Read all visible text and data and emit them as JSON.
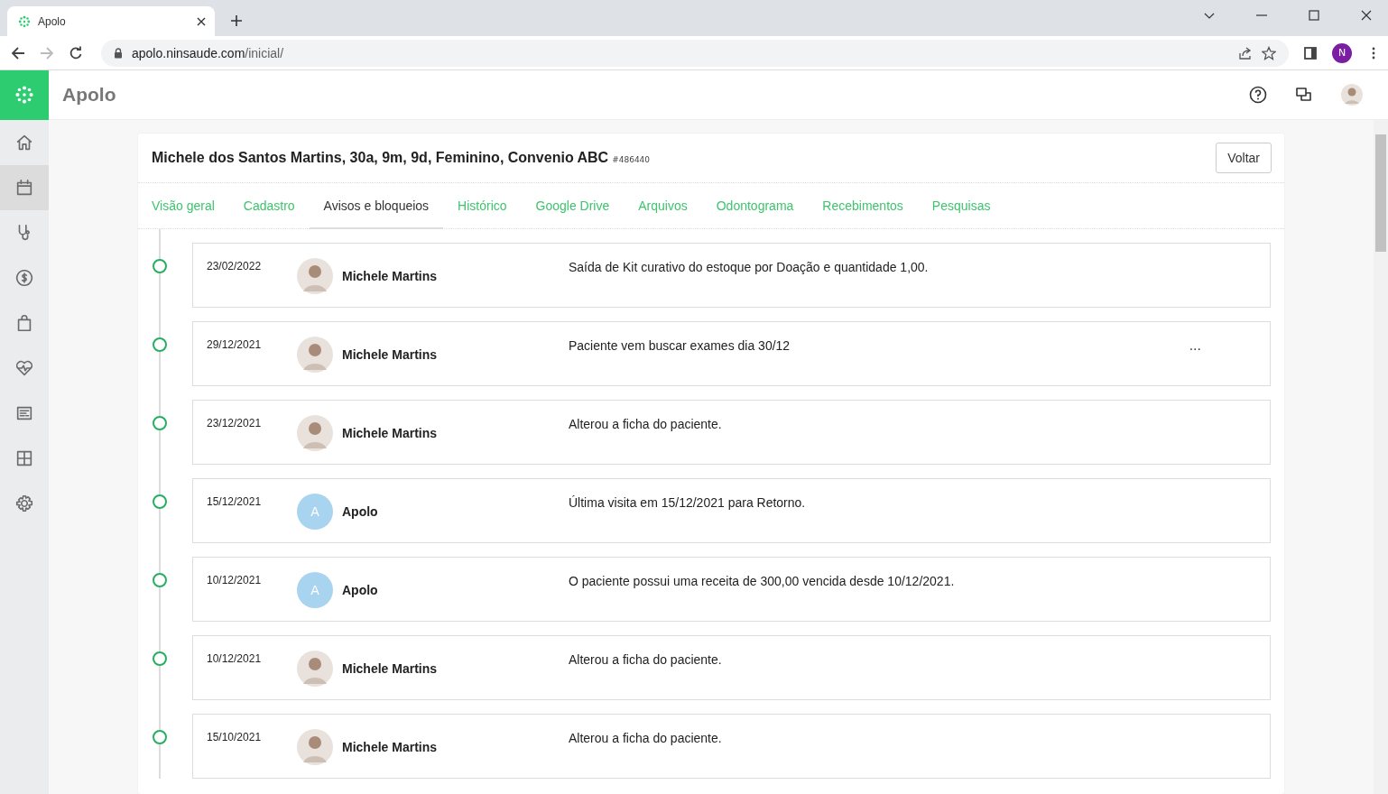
{
  "browser": {
    "tab_title": "Apolo",
    "url_host": "apolo.ninsaude.com",
    "url_path": "/inicial/",
    "profile_initial": "N"
  },
  "app": {
    "title": "Apolo"
  },
  "sidebar": {
    "items": [
      {
        "selected": false
      },
      {
        "selected": true
      },
      {
        "selected": false
      },
      {
        "selected": false
      },
      {
        "selected": false
      },
      {
        "selected": false
      },
      {
        "selected": false
      },
      {
        "selected": false
      },
      {
        "selected": false
      }
    ]
  },
  "patient": {
    "summary": "Michele dos Santos Martins, 30a, 9m, 9d, Feminino, Convenio ABC",
    "id": "#486440",
    "back_button": "Voltar"
  },
  "tabs": [
    {
      "label": "Visão geral",
      "selected": false
    },
    {
      "label": "Cadastro",
      "selected": false
    },
    {
      "label": "Avisos e bloqueios",
      "selected": true
    },
    {
      "label": "Histórico",
      "selected": false
    },
    {
      "label": "Google Drive",
      "selected": false
    },
    {
      "label": "Arquivos",
      "selected": false
    },
    {
      "label": "Odontograma",
      "selected": false
    },
    {
      "label": "Recebimentos",
      "selected": false
    },
    {
      "label": "Pesquisas",
      "selected": false
    }
  ],
  "entries": [
    {
      "date": "23/02/2022",
      "author": "Michele Martins",
      "kind": "photo",
      "text": "Saída de Kit curativo do estoque por Doação e quantidade 1,00."
    },
    {
      "date": "29/12/2021",
      "author": "Michele Martins",
      "kind": "photo",
      "text": "Paciente vem buscar exames dia 30/12",
      "more": "..."
    },
    {
      "date": "23/12/2021",
      "author": "Michele Martins",
      "kind": "photo",
      "text": "Alterou a ficha do paciente."
    },
    {
      "date": "15/12/2021",
      "author": "Apolo",
      "kind": "initial",
      "initial": "A",
      "text": "Última visita em 15/12/2021 para Retorno."
    },
    {
      "date": "10/12/2021",
      "author": "Apolo",
      "kind": "initial",
      "initial": "A",
      "text": "O paciente possui uma receita de 300,00 vencida desde 10/12/2021."
    },
    {
      "date": "10/12/2021",
      "author": "Michele Martins",
      "kind": "photo",
      "text": "Alterou a ficha do paciente."
    },
    {
      "date": "15/10/2021",
      "author": "Michele Martins",
      "kind": "photo",
      "text": "Alterou a ficha do paciente."
    }
  ]
}
